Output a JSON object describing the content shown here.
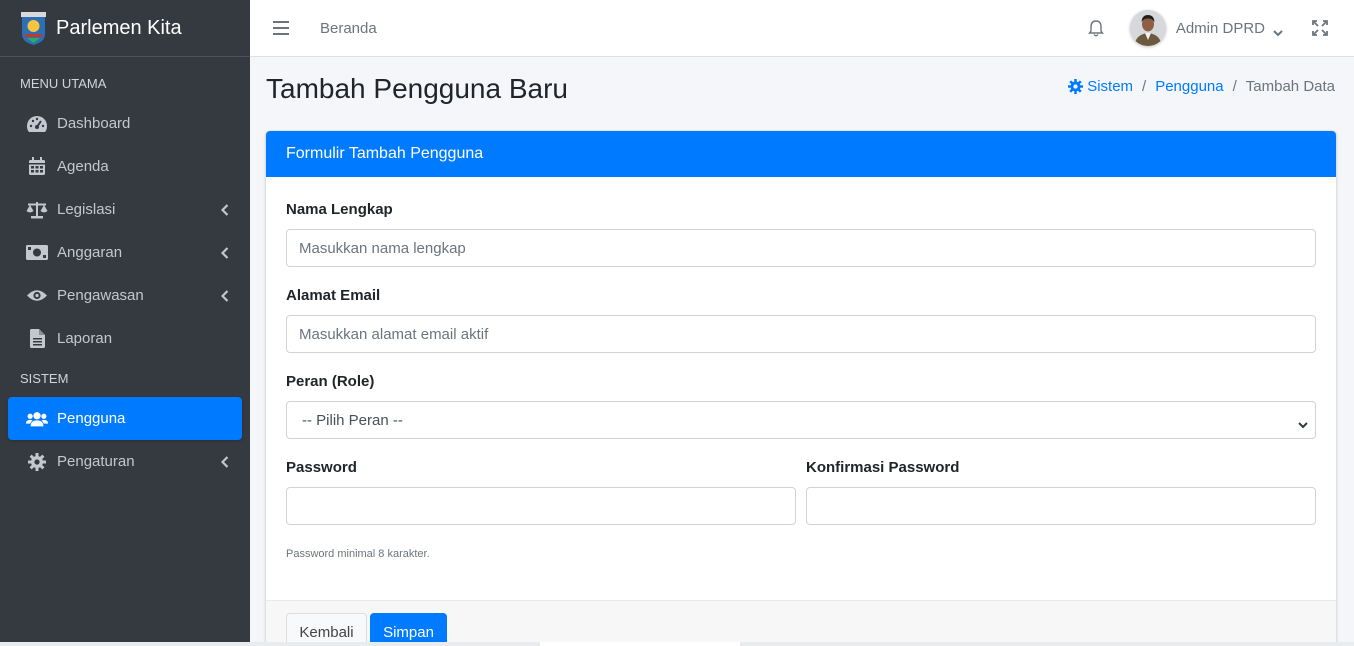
{
  "app": {
    "brand": "Parlemen Kita"
  },
  "sidebar": {
    "sections": [
      {
        "header": "MENU UTAMA"
      },
      {
        "header": "SISTEM"
      }
    ],
    "items": [
      {
        "label": "Dashboard",
        "icon": "tachometer-icon"
      },
      {
        "label": "Agenda",
        "icon": "calendar-icon"
      },
      {
        "label": "Legislasi",
        "icon": "balance-scale-icon",
        "expandable": true
      },
      {
        "label": "Anggaran",
        "icon": "money-icon",
        "expandable": true
      },
      {
        "label": "Pengawasan",
        "icon": "eye-icon",
        "expandable": true
      },
      {
        "label": "Laporan",
        "icon": "file-icon"
      },
      {
        "label": "Pengguna",
        "icon": "users-icon",
        "active": true
      },
      {
        "label": "Pengaturan",
        "icon": "gear-icon",
        "expandable": true
      }
    ]
  },
  "topbar": {
    "home_link": "Beranda",
    "user_name": "Admin DPRD"
  },
  "page": {
    "title": "Tambah Pengguna Baru",
    "breadcrumb": [
      "Sistem",
      "Pengguna",
      "Tambah Data"
    ]
  },
  "form": {
    "card_title": "Formulir Tambah Pengguna",
    "name_label": "Nama Lengkap",
    "name_placeholder": "Masukkan nama lengkap",
    "email_label": "Alamat Email",
    "email_placeholder": "Masukkan alamat email aktif",
    "role_label": "Peran (Role)",
    "role_selected": "-- Pilih Peran --",
    "password_label": "Password",
    "password_confirm_label": "Konfirmasi Password",
    "password_help": "Password minimal 8 karakter.",
    "back_button": "Kembali",
    "save_button": "Simpan"
  },
  "colors": {
    "sidebar_bg": "#343a40",
    "primary": "#007bff",
    "content_bg": "#f4f6f9"
  }
}
